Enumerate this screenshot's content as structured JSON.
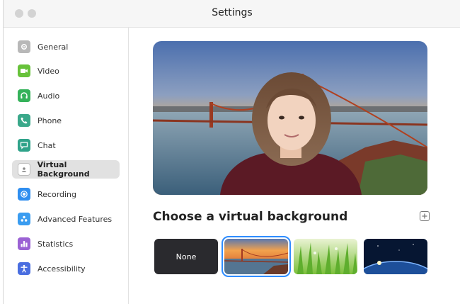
{
  "window": {
    "title": "Settings"
  },
  "sidebar": {
    "items": [
      {
        "label": "General",
        "icon": "gear-icon",
        "color": "#b8b8b8",
        "active": false
      },
      {
        "label": "Video",
        "icon": "video-camera-icon",
        "color": "#67c23a",
        "active": false
      },
      {
        "label": "Audio",
        "icon": "headphones-icon",
        "color": "#35b25a",
        "active": false
      },
      {
        "label": "Phone",
        "icon": "phone-icon",
        "color": "#3aa88a",
        "active": false
      },
      {
        "label": "Chat",
        "icon": "chat-bubble-icon",
        "color": "#2fa38a",
        "active": false
      },
      {
        "label": "Virtual Background",
        "icon": "person-card-icon",
        "color": "#9a9a9a",
        "active": true
      },
      {
        "label": "Recording",
        "icon": "record-icon",
        "color": "#2f8ef0",
        "active": false
      },
      {
        "label": "Advanced Features",
        "icon": "advanced-features-icon",
        "color": "#3a9cf0",
        "active": false
      },
      {
        "label": "Statistics",
        "icon": "bar-chart-icon",
        "color": "#9b62d4",
        "active": false
      },
      {
        "label": "Accessibility",
        "icon": "accessibility-icon",
        "color": "#4a6ee0",
        "active": false
      }
    ]
  },
  "main": {
    "heading": "Choose a virtual background",
    "thumbnails": [
      {
        "label": "None",
        "selected": false
      },
      {
        "label": "",
        "name": "golden-gate",
        "selected": true
      },
      {
        "label": "",
        "name": "grass",
        "selected": false
      },
      {
        "label": "",
        "name": "earth-space",
        "selected": false
      }
    ]
  },
  "colors": {
    "accent": "#2d8cff",
    "selected_nav": "#e1e1e1"
  }
}
